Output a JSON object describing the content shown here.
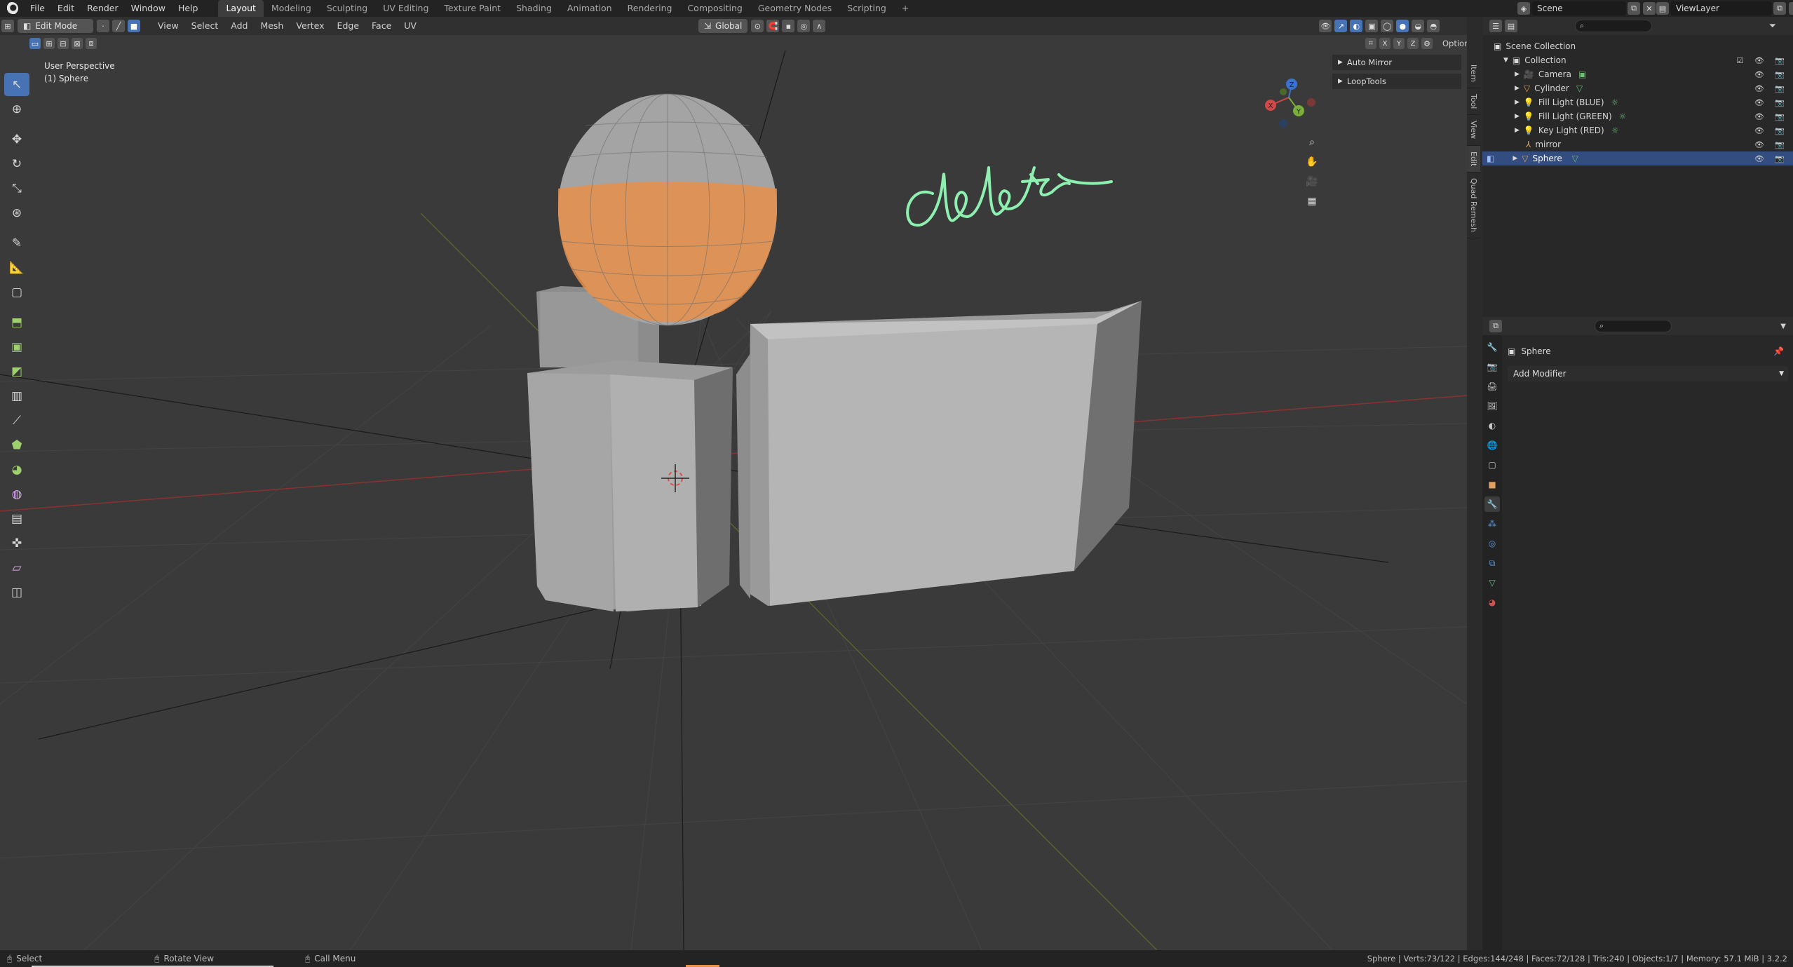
{
  "menu": {
    "items": [
      "File",
      "Edit",
      "Render",
      "Window",
      "Help"
    ],
    "workspaces": [
      "Layout",
      "Modeling",
      "Sculpting",
      "UV Editing",
      "Texture Paint",
      "Shading",
      "Animation",
      "Rendering",
      "Compositing",
      "Geometry Nodes",
      "Scripting"
    ],
    "active_workspace": "Layout",
    "add_tab": "+",
    "scene_label": "Scene",
    "view_layer_label": "ViewLayer"
  },
  "viewport_header": {
    "mode": "Edit Mode",
    "menus": [
      "View",
      "Select",
      "Add",
      "Mesh",
      "Vertex",
      "Edge",
      "Face",
      "UV"
    ],
    "transform_orientation": "Global",
    "axes": [
      "X",
      "Y",
      "Z"
    ],
    "options_label": "Options"
  },
  "viewport": {
    "view_name": "User Perspective",
    "object_name": "(1) Sphere",
    "handwritten_annotation": "delete",
    "annotation_color": "#8ef0b0",
    "selection_color": "#e8914b",
    "gizmo": {
      "x": "X",
      "y": "Y",
      "z": "Z"
    }
  },
  "last_operator": {
    "items": [
      "Auto Mirror",
      "LoopTools"
    ]
  },
  "npanel_tabs": [
    "Item",
    "Tool",
    "View",
    "Edit",
    "Quad Remesh"
  ],
  "outliner": {
    "root": "Scene Collection",
    "collection": "Collection",
    "items": [
      {
        "name": "Camera",
        "icon": "camera-icon",
        "color": "#e0a060"
      },
      {
        "name": "Cylinder",
        "icon": "mesh-icon",
        "color": "#e0a060"
      },
      {
        "name": "Fill Light (BLUE)",
        "icon": "light-icon",
        "color": "#e0a060"
      },
      {
        "name": "Fill Light (GREEN)",
        "icon": "light-icon",
        "color": "#e0a060"
      },
      {
        "name": "Key Light (RED)",
        "icon": "light-icon",
        "color": "#e0a060"
      },
      {
        "name": "mirror",
        "icon": "empty-icon",
        "color": "#e0a060"
      },
      {
        "name": "Sphere",
        "icon": "mesh-icon",
        "color": "#e0a060",
        "selected": true
      }
    ]
  },
  "properties": {
    "object_name": "Sphere",
    "add_modifier": "Add Modifier"
  },
  "statusbar": {
    "select": "Select",
    "rotate_view": "Rotate View",
    "call_menu": "Call Menu",
    "stats": "Sphere | Verts:73/122 | Edges:144/248 | Faces:72/128 | Tris:240 | Objects:1/7 | Memory: 57.1 MiB | 3.2.2"
  }
}
